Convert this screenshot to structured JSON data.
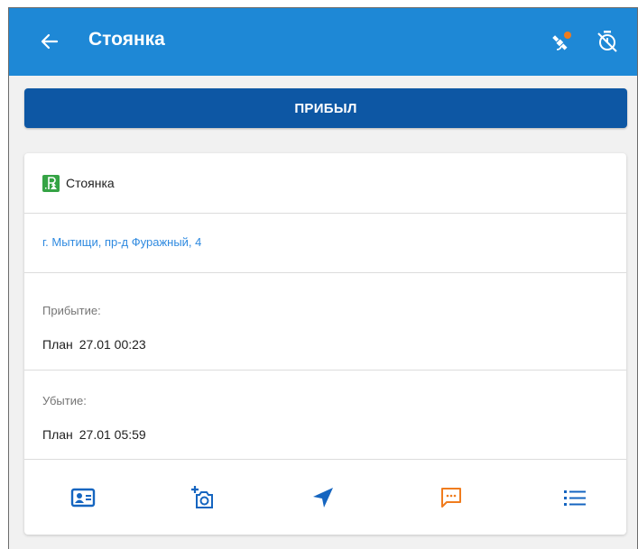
{
  "header": {
    "title": "Стоянка",
    "icons": [
      "back-arrow-icon",
      "satellite-icon",
      "timer-off-icon"
    ]
  },
  "arrived_button": {
    "label": "ПРИБЫЛ"
  },
  "card": {
    "type": {
      "icon": "parking-tree-icon",
      "label": "Стоянка"
    },
    "address": "г. Мытищи, пр-д Фуражный, 4",
    "arrival": {
      "label": "Прибытие:",
      "plan_word": "План",
      "plan_time": "27.01 00:23"
    },
    "departure": {
      "label": "Убытие:",
      "plan_word": "План",
      "plan_time": "27.01 05:59"
    },
    "actions": [
      "contact-card-icon",
      "add-photo-icon",
      "navigate-icon",
      "chat-icon",
      "list-icon"
    ]
  },
  "colors": {
    "toolbar": "#1e88d6",
    "primary_button": "#0d57a4",
    "accent_blue": "#1565c0",
    "accent_orange": "#f07c1e",
    "link": "#2f8ae0",
    "type_badge": "#35a345"
  }
}
